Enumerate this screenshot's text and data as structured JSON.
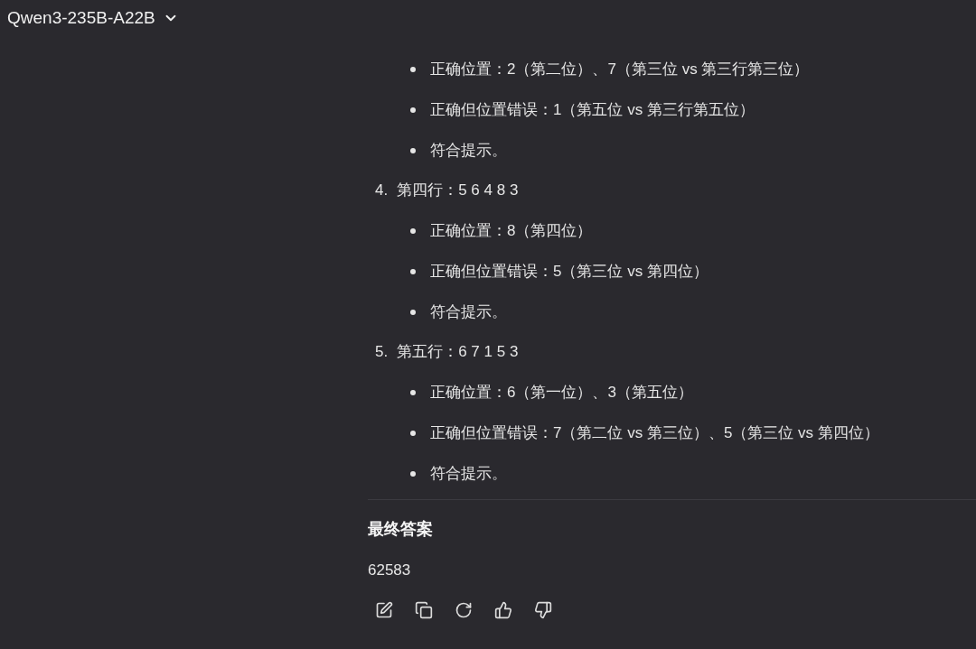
{
  "header": {
    "model": "Qwen3-235B-A22B"
  },
  "previous_item_bullets": [
    "正确位置：2（第二位）、7（第三位 vs 第三行第三位）",
    "正确但位置错误：1（第五位 vs 第三行第五位）",
    "符合提示。"
  ],
  "items": [
    {
      "number": "4.",
      "text": "第四行：5 6 4 8 3",
      "bullets": [
        "正确位置：8（第四位）",
        "正确但位置错误：5（第三位 vs 第四位）",
        "符合提示。"
      ]
    },
    {
      "number": "5.",
      "text": "第五行：6 7 1 5 3",
      "bullets": [
        "正确位置：6（第一位）、3（第五位）",
        "正确但位置错误：7（第二位 vs 第三位）、5（第三位 vs 第四位）",
        "符合提示。"
      ]
    }
  ],
  "final": {
    "heading": "最终答案",
    "answer": "62583"
  },
  "actions": [
    {
      "kind": "edit"
    },
    {
      "kind": "copy"
    },
    {
      "kind": "regenerate"
    },
    {
      "kind": "like"
    },
    {
      "kind": "dislike"
    }
  ]
}
